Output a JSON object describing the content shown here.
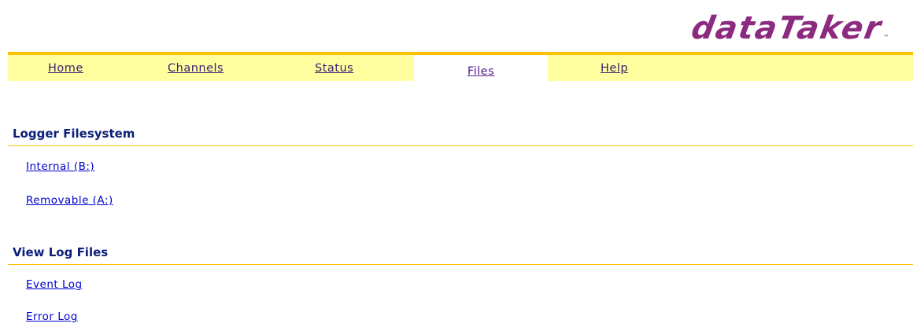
{
  "brand": {
    "name": "dataTaker",
    "trademark": "™"
  },
  "nav": {
    "tabs": [
      {
        "label": "Home",
        "active": false
      },
      {
        "label": "Channels",
        "active": false
      },
      {
        "label": "Status",
        "active": false
      },
      {
        "label": "Files",
        "active": true
      },
      {
        "label": "Help",
        "active": false
      }
    ]
  },
  "sections": [
    {
      "heading": "Logger Filesystem",
      "links": [
        "Internal (B:)",
        "Removable (A:)"
      ]
    },
    {
      "heading": "View Log Files",
      "links": [
        "Event Log",
        "Error Log"
      ]
    }
  ],
  "colors": {
    "brand": "#8b2a7e",
    "nav_background": "#ffff9f",
    "accent_rule": "#ffc000",
    "heading_text": "#0b1f7a",
    "link_text": "#0000cc"
  }
}
